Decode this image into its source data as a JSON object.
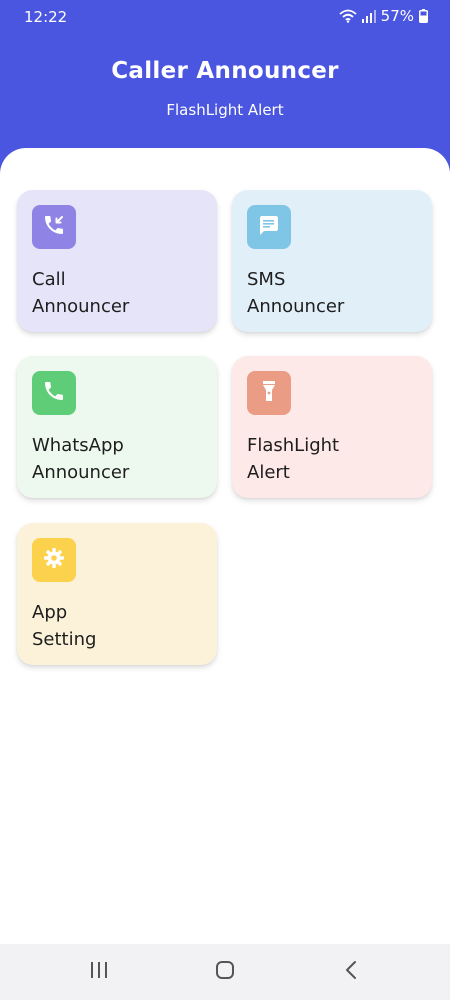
{
  "status_bar": {
    "time": "12:22",
    "battery": "57%",
    "icons": [
      "wifi-icon",
      "signal-icon",
      "battery-icon"
    ]
  },
  "header": {
    "title": "Caller Announcer",
    "subtitle": "FlashLight Alert"
  },
  "colors": {
    "header_bg": "#4a55e0",
    "content_bg": "#ffffff"
  },
  "cards": [
    {
      "label": "Call\nAnnouncer",
      "icon": "phone-incoming-icon",
      "bg": "#e5e4f8",
      "icon_bg": "#8f83e6"
    },
    {
      "label": "SMS\nAnnouncer",
      "icon": "message-icon",
      "bg": "#e1eff9",
      "icon_bg": "#7fc5e6"
    },
    {
      "label": "WhatsApp\nAnnouncer",
      "icon": "phone-icon",
      "bg": "#edf8ef",
      "icon_bg": "#5fcc77"
    },
    {
      "label": "FlashLight\nAlert",
      "icon": "flashlight-icon",
      "bg": "#fde9e8",
      "icon_bg": "#ea9c84"
    },
    {
      "label": "App\nSetting",
      "icon": "gear-icon",
      "bg": "#fbf2d9",
      "icon_bg": "#fcd24d"
    }
  ],
  "nav_bar": {
    "recents": "recents-icon",
    "home": "home-icon",
    "back": "back-icon"
  }
}
